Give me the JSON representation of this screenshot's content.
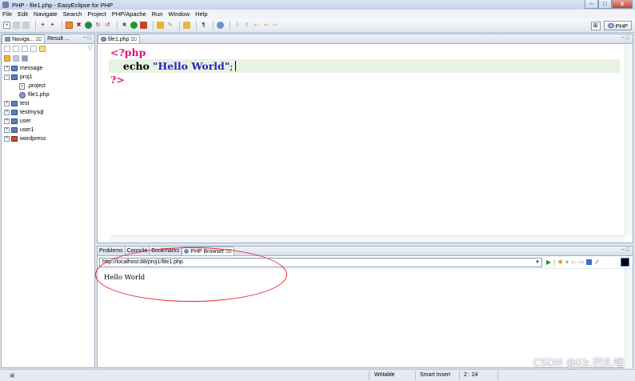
{
  "window": {
    "title": "PHP - file1.php - EasyEclipse for PHP",
    "controls": {
      "minimize": "–",
      "maximize": "□",
      "close": "x"
    }
  },
  "menubar": [
    "File",
    "Edit",
    "Navigate",
    "Search",
    "Project",
    "PHP/Apache",
    "Run",
    "Window",
    "Help"
  ],
  "perspective": {
    "label": "PHP"
  },
  "navigator": {
    "tabs": [
      {
        "label": "Naviga...",
        "close": "⌧"
      },
      {
        "label": "Result ..."
      }
    ],
    "tree": [
      {
        "label": "message",
        "type": "project",
        "expander": "+"
      },
      {
        "label": "proj1",
        "type": "project",
        "expander": "−"
      },
      {
        "label": ".project",
        "type": "xfile",
        "indent": 2
      },
      {
        "label": "file1.php",
        "type": "php",
        "indent": 2
      },
      {
        "label": "test",
        "type": "project",
        "expander": "+"
      },
      {
        "label": "testmysql",
        "type": "project",
        "expander": "+"
      },
      {
        "label": "user",
        "type": "project",
        "expander": "+"
      },
      {
        "label": "user1",
        "type": "project",
        "expander": "+"
      },
      {
        "label": "wordpress",
        "type": "project-wp",
        "expander": "+"
      }
    ]
  },
  "editor": {
    "tab": {
      "label": "file1.php",
      "close": "⌧"
    },
    "code": {
      "line1_open": "<?php",
      "line2_keyword": "echo",
      "line2_string": "\"Hello World\"",
      "line2_end": ";",
      "line3_close": "?>"
    }
  },
  "bottom_panel": {
    "tabs": [
      "Problems",
      "Console",
      "Bookmarks",
      "PHP Browser"
    ],
    "active_tab_close": "⌧",
    "url": "http://localhost:88/proj1/file1.php",
    "content": "Hello World"
  },
  "statusbar": {
    "mode": "Writable",
    "insert_mode": "Smart Insert",
    "position": "2 : 24"
  },
  "watermark": "CSDN @Kk.巴扎嘿",
  "colors": {
    "php_tag": "#e0147d",
    "string": "#2a24b8",
    "current_line": "#e8f2e3",
    "annotation": "#e2232a"
  }
}
